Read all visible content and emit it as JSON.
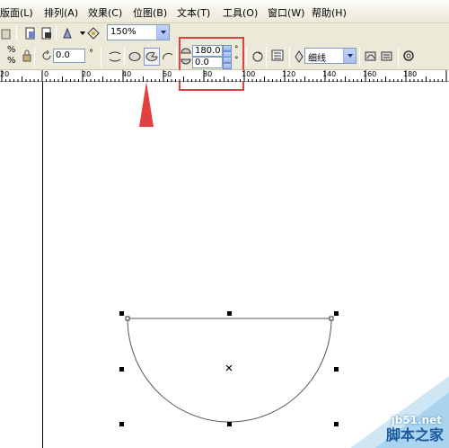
{
  "menu": {
    "items": [
      "版面(L)",
      "排列(A)",
      "效果(C)",
      "位图(B)",
      "文本(T)",
      "工具(O)",
      "窗口(W)",
      "帮助(H)"
    ]
  },
  "toolbar1": {
    "zoom_value": "150%"
  },
  "toolbar2": {
    "percent_sign_top": "%",
    "percent_sign_bottom": "%",
    "rotation_value": "0.0",
    "rotation_unit": "°",
    "start_angle": "180.0",
    "end_angle": "0.0",
    "angle_unit_top": "°",
    "angle_unit_bottom": "°",
    "outline_width": "细线"
  },
  "ruler": {
    "labels": [
      "20",
      "0",
      "20",
      "40",
      "60",
      "80",
      "100",
      "120",
      "140",
      "160",
      "180"
    ]
  },
  "watermark": {
    "site": "jb51.net",
    "name": "脚本之家"
  },
  "colors": {
    "annotation_red": "#e04040",
    "toolbar_bg": "#ece9d8"
  }
}
